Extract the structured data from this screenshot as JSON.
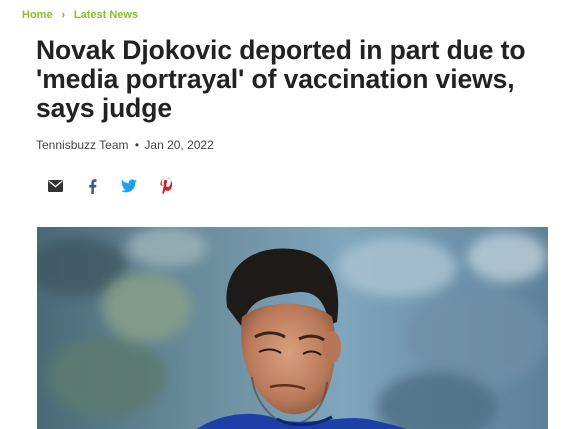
{
  "breadcrumb": {
    "home_label": "Home",
    "separator": "›",
    "section_label": "Latest News"
  },
  "article": {
    "title": "Novak Djokovic deported in part due to 'media portrayal' of vaccination views, says judge",
    "author": "Tennisbuzz Team",
    "byline_separator": "•",
    "date": "Jan 20, 2022"
  },
  "share": {
    "icons": [
      "email-icon",
      "facebook-icon",
      "twitter-icon",
      "pinterest-icon"
    ]
  },
  "colors": {
    "breadcrumb": "#8cbf2a",
    "facebook": "#3b5998",
    "twitter": "#1da1f2",
    "pinterest": "#cb2027",
    "email": "#333333",
    "shirt": "#1d3fa8"
  }
}
